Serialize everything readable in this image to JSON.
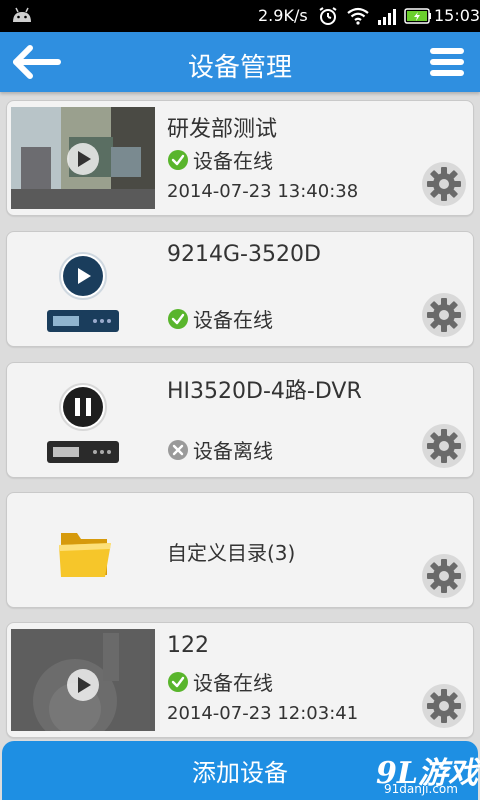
{
  "status_bar": {
    "speed": "2.9K/s",
    "time": "15:03",
    "icons": [
      "android-icon",
      "alarm-icon",
      "wifi-icon",
      "signal-icon",
      "battery-icon"
    ]
  },
  "header": {
    "title": "设备管理",
    "back_icon": "back-arrow-icon",
    "menu_icon": "menu-icon"
  },
  "devices": [
    {
      "name": "研发部测试",
      "status": "设备在线",
      "status_type": "online",
      "date": "2014-07-23 13:40:38",
      "thumb": "camera-snapshot"
    },
    {
      "name": "9214G-3520D",
      "status": "设备在线",
      "status_type": "online",
      "date": "",
      "thumb": "dvr-play"
    },
    {
      "name": "HI3520D-4路-DVR",
      "status": "设备离线",
      "status_type": "offline",
      "date": "",
      "thumb": "dvr-pause"
    },
    {
      "name": "自定义目录(3)",
      "status": "",
      "status_type": "folder",
      "date": "",
      "thumb": "folder"
    },
    {
      "name": "122",
      "status": "设备在线",
      "status_type": "online",
      "date": "2014-07-23 12:03:41",
      "thumb": "camera-placeholder"
    }
  ],
  "footer": {
    "add_button": "添加设备",
    "watermark_main": "9L游戏",
    "watermark_sub": "91danji.com"
  },
  "colors": {
    "header_bg": "#2f8fe0",
    "online_green": "#59b52c",
    "offline_gray": "#9a9a9a"
  }
}
